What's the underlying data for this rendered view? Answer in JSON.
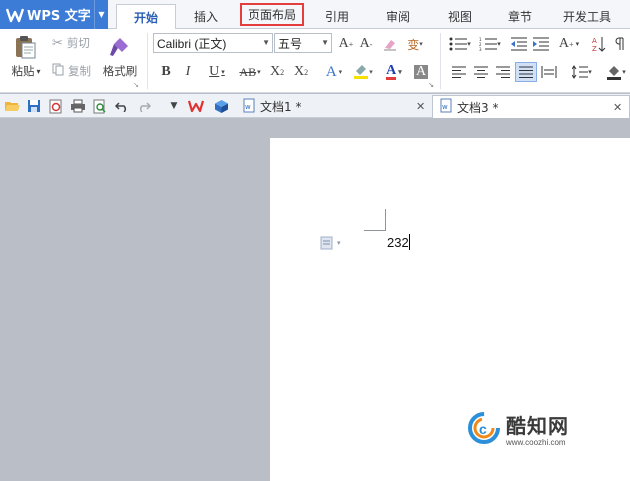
{
  "app": {
    "name": "WPS 文字"
  },
  "menu": {
    "tabs": [
      {
        "label": "开始",
        "active": true
      },
      {
        "label": "插入"
      },
      {
        "label": "页面布局",
        "highlighted": true
      },
      {
        "label": "引用"
      },
      {
        "label": "审阅"
      },
      {
        "label": "视图"
      },
      {
        "label": "章节"
      },
      {
        "label": "开发工具"
      }
    ]
  },
  "ribbon": {
    "paste_label": "粘贴",
    "cut_label": "剪切",
    "copy_label": "复制",
    "format_painter_label": "格式刷",
    "font_name": "Calibri (正文)",
    "font_size": "五号",
    "bold": "B",
    "italic": "I",
    "underline": "U",
    "strikethrough": "AB",
    "superscript": "X",
    "subscript": "X",
    "font_color_letter": "A",
    "text_effect_letter": "A",
    "char_shading_letter": "A",
    "grow_font": "A",
    "shrink_font": "A",
    "phonetic_char": "变",
    "case_letter": "A"
  },
  "document_tabs": [
    {
      "label": "文档1 *",
      "active": false
    },
    {
      "label": "文档3 *",
      "active": true
    }
  ],
  "document": {
    "body_text": "232"
  },
  "watermark": {
    "title": "酷知网",
    "url": "www.coozhi.com"
  },
  "colors": {
    "brand_blue": "#3c7bd6",
    "highlight_red": "#e43d3d",
    "workspace_gray": "#b9bec7"
  }
}
